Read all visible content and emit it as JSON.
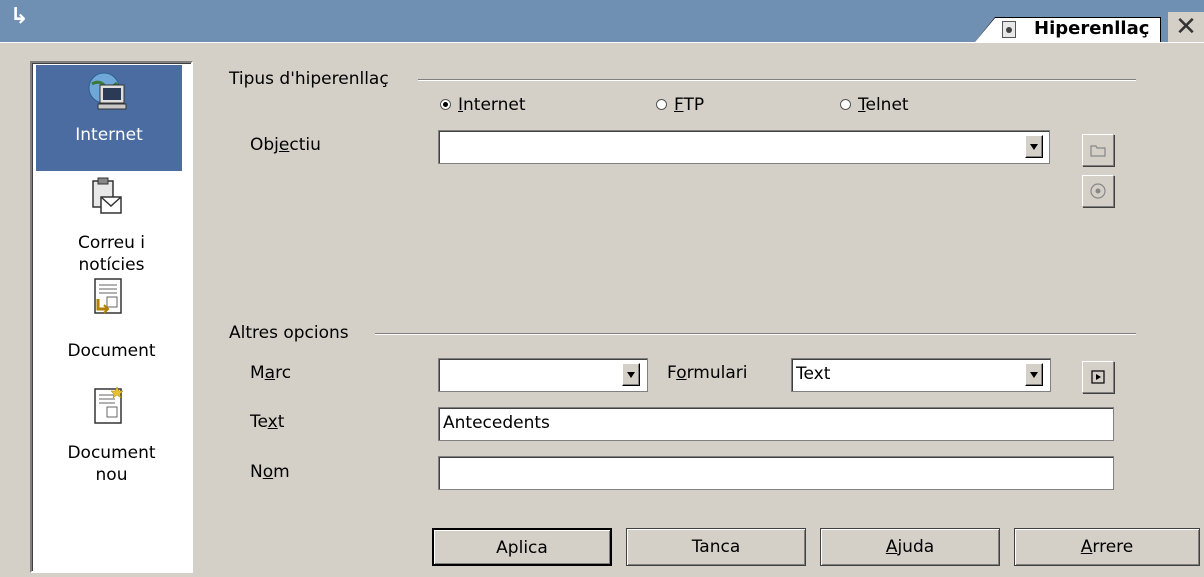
{
  "window": {
    "title": "Hiperenllaç",
    "close_glyph": "✕",
    "corner_glyph": "↳"
  },
  "sidebar": {
    "items": [
      {
        "label": "Internet",
        "icon": "globe-monitor-icon",
        "selected": true
      },
      {
        "label_line1": "Correu i",
        "label_line2": "notícies",
        "icon": "mail-clipboard-icon"
      },
      {
        "label": "Document",
        "icon": "document-link-icon"
      },
      {
        "label_line1": "Document",
        "label_line2": "nou",
        "icon": "new-document-icon"
      }
    ]
  },
  "hyperlink_type": {
    "legend": "Tipus d'hiperenllaç",
    "options": [
      {
        "pre": "",
        "mnemonic": "I",
        "post": "nternet",
        "checked": true
      },
      {
        "pre": "",
        "mnemonic": "F",
        "post": "TP",
        "checked": false
      },
      {
        "pre": "",
        "mnemonic": "T",
        "post": "elnet",
        "checked": false
      }
    ],
    "target": {
      "pre": "Obj",
      "mnemonic": "e",
      "post": "ctiu",
      "value": ""
    }
  },
  "other_options": {
    "legend": "Altres opcions",
    "frame": {
      "pre": "M",
      "mnemonic": "a",
      "post": "rc",
      "value": ""
    },
    "form": {
      "pre": "F",
      "mnemonic": "o",
      "post": "rmulari",
      "value": "Text"
    },
    "text": {
      "pre": "Te",
      "mnemonic": "x",
      "post": "t",
      "value": "Antecedents"
    },
    "name": {
      "pre": "N",
      "mnemonic": "o",
      "post": "m",
      "value": ""
    }
  },
  "buttons": {
    "apply": "Aplica",
    "close": "Tanca",
    "help_mnemonic": "A",
    "help_rest": "juda",
    "back_mnemonic": "A",
    "back_rest": "rrere"
  }
}
